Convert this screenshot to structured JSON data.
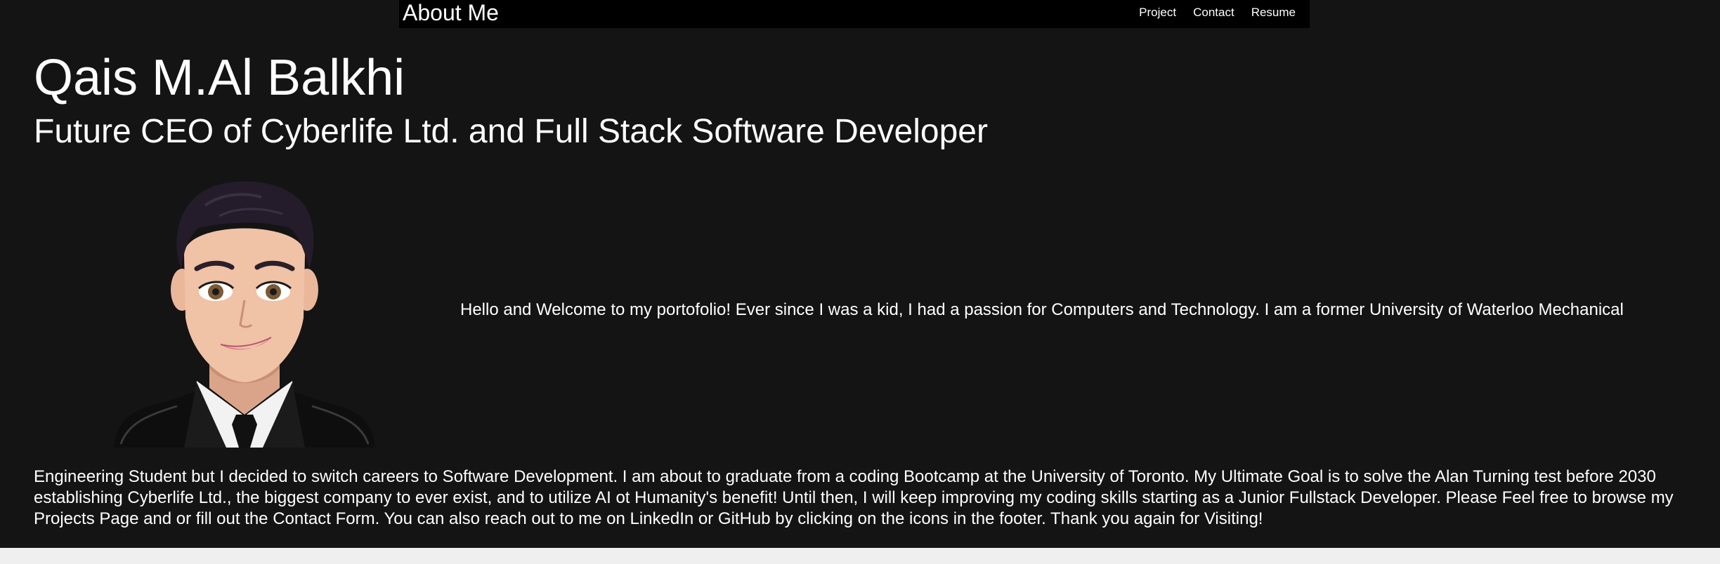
{
  "navbar": {
    "brand": "About Me",
    "links": [
      "Project",
      "Contact",
      "Resume"
    ]
  },
  "header": {
    "name": "Qais M.Al Balkhi",
    "subtitle": "Future CEO of Cyberlife Ltd. and Full Stack Software Developer"
  },
  "bio": {
    "line1": "Hello and Welcome to my portofolio! Ever since I was a kid, I had a passion for Computers and Technology. I am a former University of Waterloo Mechanical",
    "rest": "Engineering Student but I decided to switch careers to Software Development. I am about to graduate from a coding Bootcamp at the University of Toronto. My Ultimate Goal is to solve the Alan Turning test before 2030 establishing Cyberlife Ltd., the biggest company to ever exist, and to utilize AI ot Humanity's benefit! Until then, I will keep improving my coding skills starting as a Junior Fullstack Developer. Please Feel free to browse my Projects Page and or fill out the Contact Form. You can also reach out to me on LinkedIn or GitHub by clicking on the icons in the footer. Thank you again for Visiting!"
  },
  "colors": {
    "page_background": "#141414",
    "navbar_background": "#000000",
    "text": "#ffffff",
    "outer_background": "#efefef"
  },
  "icons": {
    "avatar": "cartoon-portrait-avatar"
  }
}
